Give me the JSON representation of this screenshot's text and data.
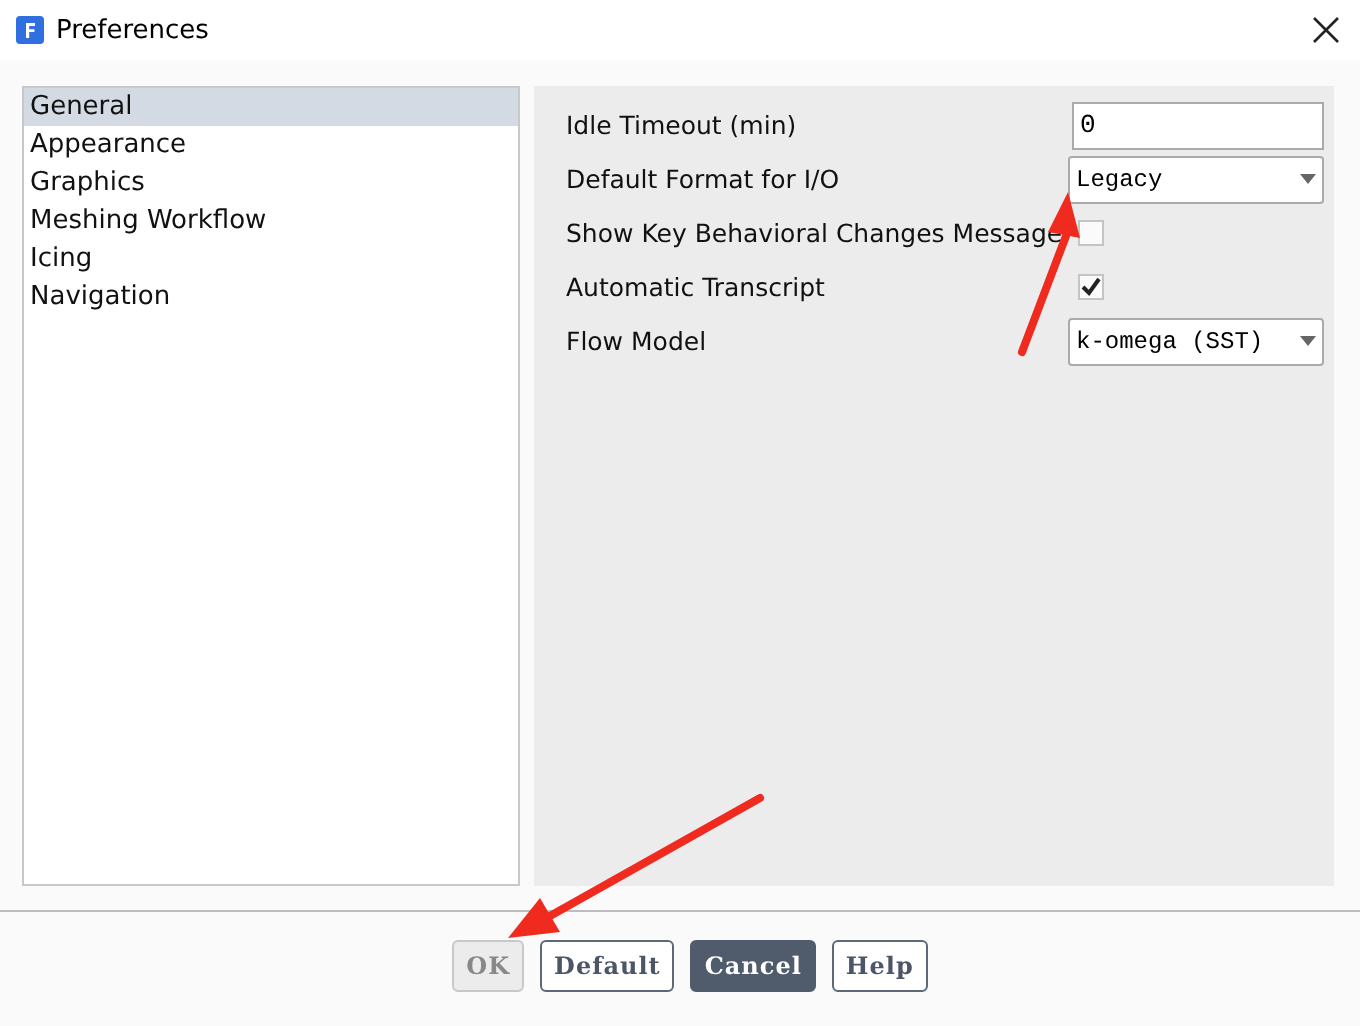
{
  "window": {
    "title": "Preferences"
  },
  "sidebar": {
    "items": [
      {
        "label": "General",
        "selected": true
      },
      {
        "label": "Appearance",
        "selected": false
      },
      {
        "label": "Graphics",
        "selected": false
      },
      {
        "label": "Meshing Workflow",
        "selected": false
      },
      {
        "label": "Icing",
        "selected": false
      },
      {
        "label": "Navigation",
        "selected": false
      }
    ]
  },
  "settings": [
    {
      "kind": "text",
      "label": "Idle Timeout (min)",
      "value": "0"
    },
    {
      "kind": "dropdown",
      "label": "Default Format for I/O",
      "value": "Legacy"
    },
    {
      "kind": "checkbox",
      "label": "Show Key Behavioral Changes Message",
      "checked": false
    },
    {
      "kind": "checkbox",
      "label": "Automatic Transcript",
      "checked": true
    },
    {
      "kind": "dropdown",
      "label": "Flow Model",
      "value": "k-omega (SST)"
    }
  ],
  "buttons": [
    {
      "label": "OK",
      "kind": "plain",
      "disabled": true
    },
    {
      "label": "Default",
      "kind": "plain",
      "disabled": false
    },
    {
      "label": "Cancel",
      "kind": "primary",
      "disabled": false
    },
    {
      "label": "Help",
      "kind": "plain",
      "disabled": false
    }
  ],
  "annotations": [
    {
      "kind": "arrow"
    },
    {
      "kind": "arrow"
    }
  ]
}
